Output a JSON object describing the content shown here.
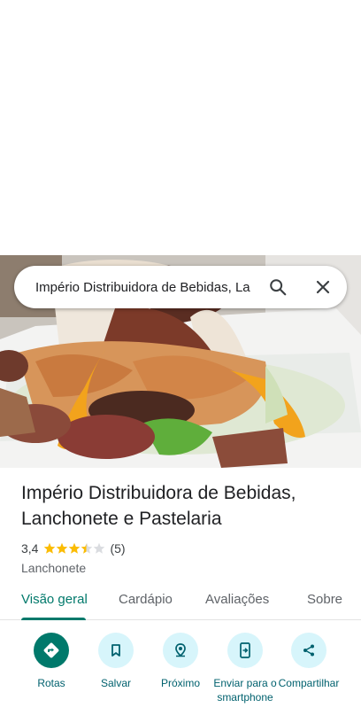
{
  "search": {
    "query": "Império Distribuidora de Bebidas, La",
    "search_icon": "search-icon",
    "close_icon": "close-icon"
  },
  "place": {
    "name": "Império Distribuidora de Bebidas, Lanchonete e Pastelaria",
    "rating": "3,4",
    "rating_stars": 3.4,
    "review_count": "(5)",
    "category": "Lanchonete"
  },
  "tabs": [
    {
      "label": "Visão geral",
      "active": true
    },
    {
      "label": "Cardápio",
      "active": false
    },
    {
      "label": "Avaliações",
      "active": false
    },
    {
      "label": "Sobre",
      "active": false
    }
  ],
  "actions": [
    {
      "label": "Rotas",
      "icon": "directions-icon"
    },
    {
      "label": "Salvar",
      "icon": "bookmark-icon"
    },
    {
      "label": "Próximo",
      "icon": "nearby-icon"
    },
    {
      "label": "Enviar para o smartphone",
      "icon": "send-to-phone-icon"
    },
    {
      "label": "Compartilhar",
      "icon": "share-icon"
    }
  ],
  "colors": {
    "accent": "#00796b",
    "action_bg": "#d7f5fb",
    "star": "#fbbc04"
  }
}
